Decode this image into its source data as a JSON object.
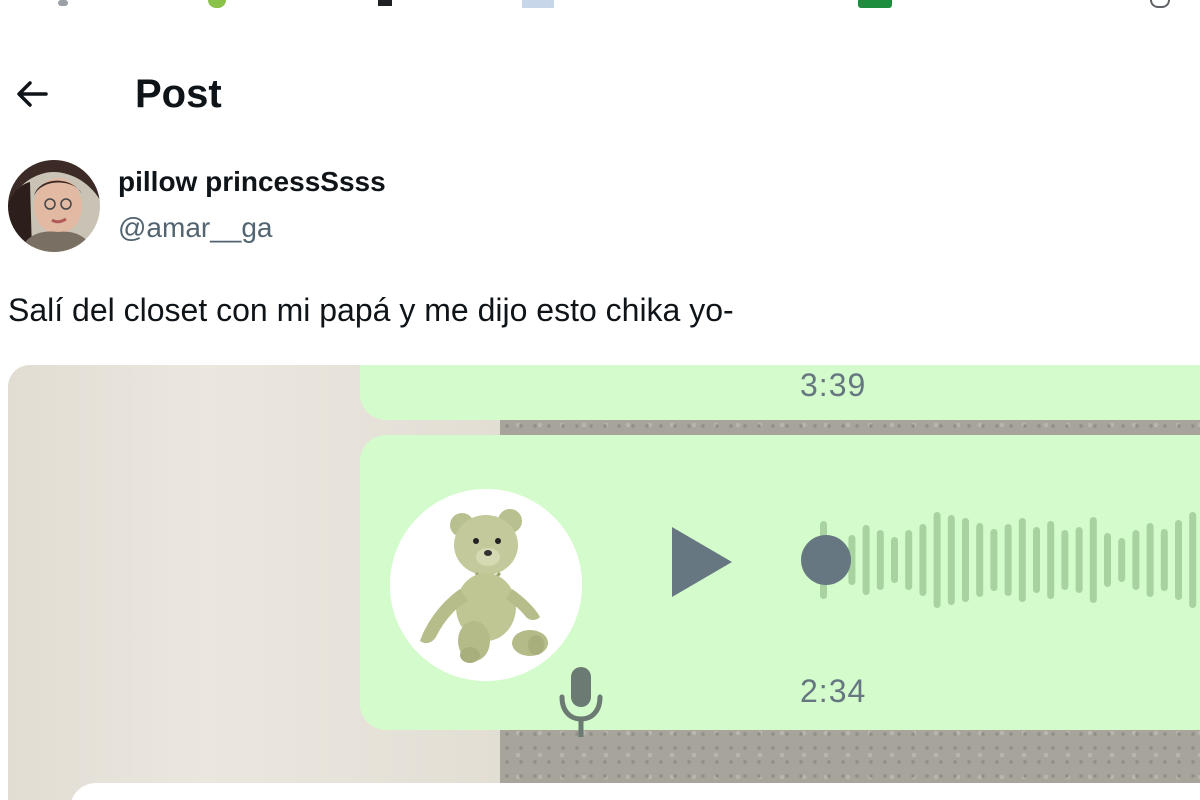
{
  "header": {
    "title": "Post",
    "back_icon": "arrow-left-icon"
  },
  "author": {
    "display_name": "pillow princessSsss",
    "handle": "@amar__ga",
    "avatar_icon": "profile-photo-icon"
  },
  "post": {
    "text": "Salí del closet con mi papá y me dijo esto chika yo-"
  },
  "media": {
    "prev_message_time": "3:39",
    "voice_note": {
      "duration": "2:34",
      "sender_avatar_icon": "teddy-bear-avatar-icon",
      "mic_icon": "microphone-icon",
      "play_icon": "play-icon"
    }
  },
  "colors": {
    "bubble": "#d4fbcb",
    "time_text": "#667781",
    "handle_text": "#536471",
    "wave_played": "#667781",
    "wave_unplayed": "#a8d3a0"
  }
}
